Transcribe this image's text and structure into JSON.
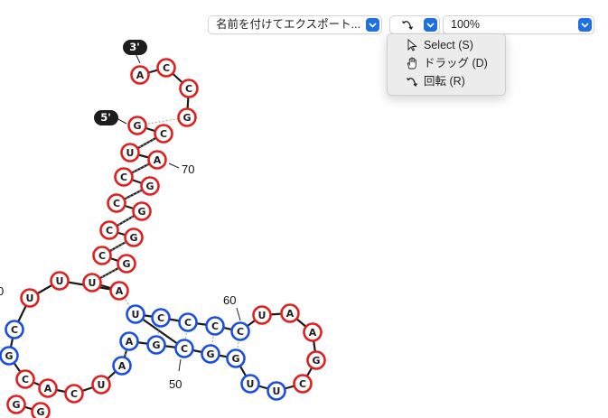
{
  "toolbar": {
    "export_label": "名前を付けてエクスポート...",
    "zoom_label": "100%",
    "tool_icon": "rotate-icon"
  },
  "tool_menu": {
    "items": [
      {
        "label": "Select (S)",
        "icon": "pointer-icon"
      },
      {
        "label": "ドラッグ (D)",
        "icon": "hand-icon"
      },
      {
        "label": "回転 (R)",
        "icon": "rotate-icon"
      }
    ]
  },
  "structure": {
    "end_3_label": "3'",
    "end_5_label": "5'",
    "position_labels": [
      "70",
      "60",
      "50",
      "0"
    ],
    "colors": {
      "red": "#e0201f",
      "blue": "#1b4fe0",
      "backbone": "#1a1a1a",
      "bond": "#9a9a9a"
    },
    "nucleotides": [
      "A",
      "C",
      "C",
      "G",
      "G",
      "C",
      "U",
      "A",
      "C",
      "G",
      "C",
      "G",
      "C",
      "G",
      "C",
      "G",
      "U",
      "A",
      "U",
      "U",
      "C",
      "G",
      "C",
      "A",
      "C",
      "U",
      "A",
      "A",
      "G",
      "C",
      "U",
      "C",
      "C",
      "C",
      "C",
      "U",
      "A",
      "A",
      "G",
      "C",
      "U",
      "U",
      "G",
      "G",
      "G",
      "G",
      "A",
      "C"
    ]
  }
}
